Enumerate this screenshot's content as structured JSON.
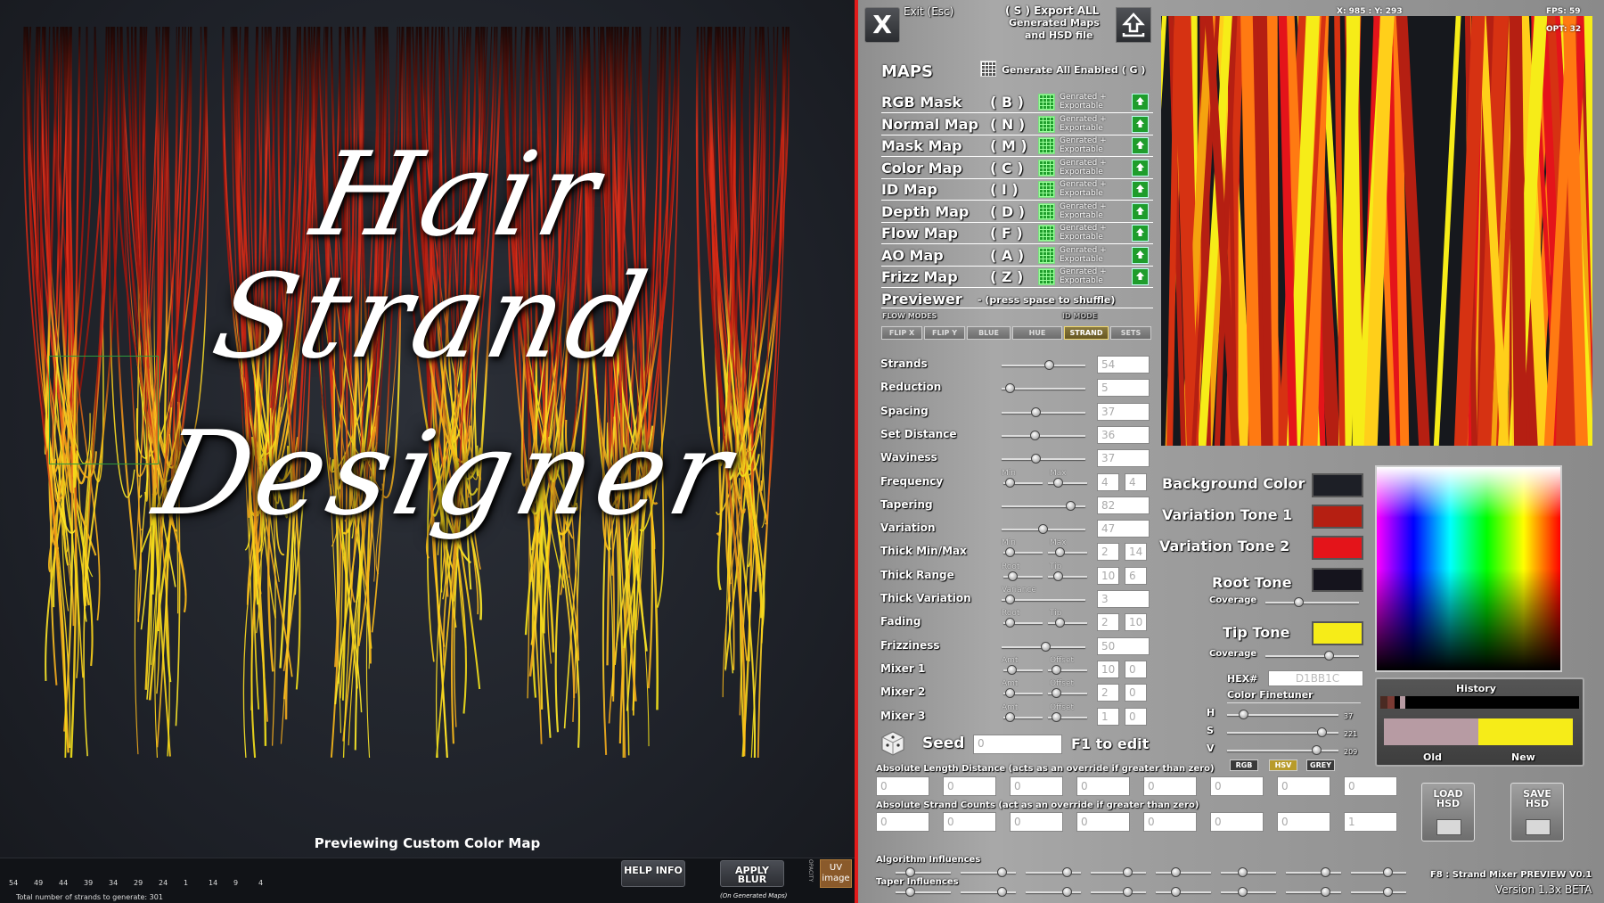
{
  "preview": {
    "title_line1": "Hair Strand",
    "title_line2": "Designer",
    "caption": "Previewing Custom Color Map",
    "strand_counts": [
      "54",
      "49",
      "44",
      "39",
      "34",
      "29",
      "24",
      "1",
      "14",
      "9",
      "4"
    ],
    "total_label": "Total number of strands to generate: 301",
    "help_button": "HELP INFO",
    "blur_button": "APPLY BLUR",
    "blur_note": "(On Generated Maps)",
    "uv_button": "UV image",
    "opacity_label": "OPACITY"
  },
  "header": {
    "exit_glyph": "X",
    "exit_label": "Exit (Esc)",
    "export_line1": "( S ) Export ALL",
    "export_line2": "Generated Maps",
    "export_line3": "and HSD file"
  },
  "maps": {
    "heading": "MAPS",
    "generate_all": "Generate All Enabled ( G )",
    "status": "Genrated +",
    "status2": "Exportable",
    "items": [
      {
        "name": "RGB Mask",
        "key": "( B )"
      },
      {
        "name": "Normal Map",
        "key": "( N )"
      },
      {
        "name": "Mask Map",
        "key": "( M )"
      },
      {
        "name": "Color Map",
        "key": "( C )"
      },
      {
        "name": "ID Map",
        "key": "( I )"
      },
      {
        "name": "Depth Map",
        "key": "( D )"
      },
      {
        "name": "Flow Map",
        "key": "( F )"
      },
      {
        "name": "AO Map",
        "key": "( A )"
      },
      {
        "name": "Frizz Map",
        "key": "( Z )"
      }
    ],
    "previewer": "Previewer",
    "previewer_hint": "- (press space to shuffle)",
    "flow_modes": "FLOW MODES",
    "id_mode": "ID MODE",
    "mode_tabs": [
      "FLIP X",
      "FLIP Y",
      "BLUE",
      "HUE",
      "STRAND",
      "SETS"
    ],
    "active_tab": "STRAND"
  },
  "sliders": [
    {
      "label": "Strands",
      "value": "54",
      "pos": 0.55
    },
    {
      "label": "Reduction",
      "value": "5",
      "pos": 0.05
    },
    {
      "label": "Spacing",
      "value": "37",
      "pos": 0.37
    },
    {
      "label": "Set Distance",
      "value": "36",
      "pos": 0.36
    },
    {
      "label": "Waviness",
      "value": "37",
      "pos": 0.37
    },
    {
      "label": "Frequency",
      "value": "4",
      "value2": "4",
      "sub1": "Min",
      "sub2": "Max",
      "pos": 0.05,
      "pos2": 0.65
    },
    {
      "label": "Tapering",
      "value": "82",
      "pos": 0.82
    },
    {
      "label": "Variation",
      "value": "47",
      "pos": 0.47
    },
    {
      "label": "Thick Min/Max",
      "value": "2",
      "value2": "14",
      "sub1": "Min",
      "sub2": "Max",
      "pos": 0.05,
      "pos2": 0.7
    },
    {
      "label": "Thick Range",
      "value": "10",
      "value2": "6",
      "sub1": "Root",
      "sub2": "Tip",
      "pos": 0.12,
      "pos2": 0.65
    },
    {
      "label": "Thick Variation",
      "value": "3",
      "sub1": "Variance",
      "pos": 0.05
    },
    {
      "label": "Fading",
      "value": "2",
      "value2": "10",
      "sub1": "Root",
      "sub2": "Tip",
      "pos": 0.05,
      "pos2": 0.7
    },
    {
      "label": "Frizziness",
      "value": "50",
      "pos": 0.5
    },
    {
      "label": "Mixer 1",
      "value": "10",
      "value2": "0",
      "sub1": "Amt",
      "sub2": "Offset",
      "pos": 0.1,
      "pos2": 0.6
    },
    {
      "label": "Mixer 2",
      "value": "2",
      "value2": "0",
      "sub1": "Amt",
      "sub2": "Offset",
      "pos": 0.05,
      "pos2": 0.6
    },
    {
      "label": "Mixer 3",
      "value": "1",
      "value2": "0",
      "sub1": "Amt",
      "sub2": "Offset",
      "pos": 0.05,
      "pos2": 0.6
    }
  ],
  "seed": {
    "label": "Seed",
    "value": "0",
    "hint": "F1 to edit"
  },
  "absolute": {
    "length_label": "Absolute Length Distance (acts as an override if greater than zero)",
    "length_values": [
      "0",
      "0",
      "0",
      "0",
      "0",
      "0",
      "0",
      "0"
    ],
    "counts_label": "Absolute Strand Counts (act as an override if greater than zero)",
    "count_values": [
      "0",
      "0",
      "0",
      "0",
      "0",
      "0",
      "0",
      "1"
    ],
    "mode_buttons": [
      "RGB",
      "HSV",
      "GREY"
    ],
    "active_mode": "HSV"
  },
  "influences": {
    "algorithm": "Algorithm Influences",
    "taper": "Taper Influences"
  },
  "status_bar": {
    "coords": "X: 985 : Y: 293",
    "fps": "FPS: 59",
    "opt": "OPT: 32"
  },
  "colors": {
    "background_label": "Background Color",
    "background": "#1d1f26",
    "var1_label": "Variation Tone 1",
    "var1": "#b51f12",
    "var2_label": "Variation Tone 2",
    "var2": "#e4141a",
    "root_label": "Root Tone",
    "root": "#15141d",
    "tip_label": "Tip Tone",
    "tip": "#f6ec18",
    "coverage_label": "Coverage",
    "hex_label": "HEX#",
    "hex_value": "D1BB1C",
    "finetuner_label": "Color Finetuner",
    "h_label": "H",
    "h_value": "37",
    "s_label": "S",
    "s_value": "221",
    "v_label": "V",
    "v_value": "209",
    "history_label": "History",
    "old_label": "Old",
    "new_label": "New",
    "old_color": "#b79ba3",
    "new_color": "#f6ec18"
  },
  "files": {
    "load": "LOAD HSD",
    "save": "SAVE HSD"
  },
  "footer": {
    "line1": "F8 : Strand Mixer PREVIEW V0.1",
    "line2": "Version 1.3x BETA"
  }
}
